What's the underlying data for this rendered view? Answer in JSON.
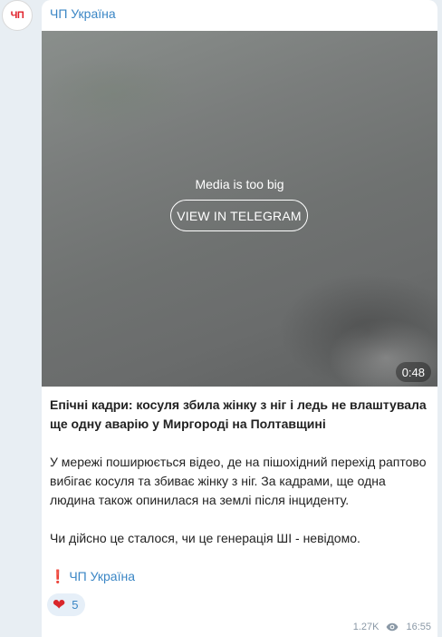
{
  "channel": {
    "avatar_text": "ЧП",
    "name": "ЧП Україна"
  },
  "media": {
    "message": "Media is too big",
    "button_label": "VIEW IN TELEGRAM",
    "duration": "0:48"
  },
  "post": {
    "headline": "Епічні кадри: косуля збила жінку з ніг і ледь не влаштувала ще одну аварію у Миргороді на Полтавщині",
    "body": "У мережі поширюється відео, де на пішохідний перехід раптово вибігає косуля та збиває жінку з ніг. За кадрами, ще одна людина також опинилася на землі після інциденту.",
    "question": "Чи дійсно це сталося, чи це генерація ШІ - невідомо.",
    "signature_mark": "❗",
    "signature_link": "ЧП Україна"
  },
  "reactions": [
    {
      "icon": "heart-icon",
      "emoji": "❤",
      "count": "5"
    }
  ],
  "meta": {
    "views": "1.27K",
    "time": "16:55"
  },
  "colors": {
    "link": "#3a86c5",
    "avatar_red": "#e0202a",
    "background": "#e8eef3"
  }
}
